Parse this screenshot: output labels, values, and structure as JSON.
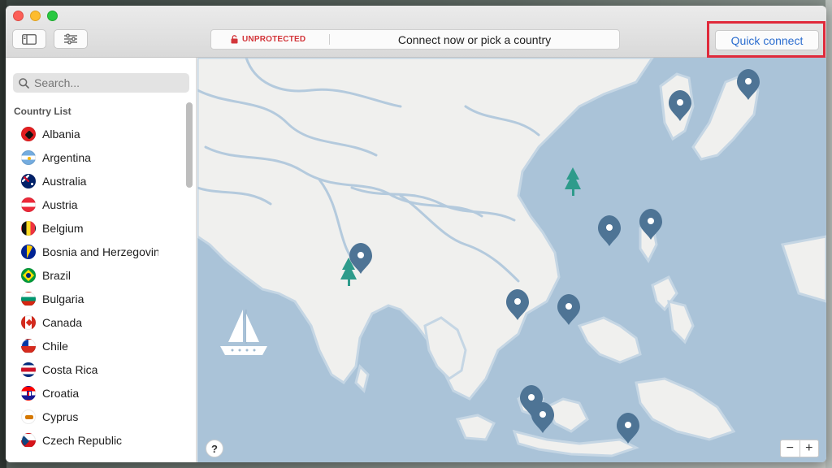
{
  "toolbar": {
    "sidebar_toggle_icon": "sidebar-icon",
    "filter_icon": "sliders-icon"
  },
  "status": {
    "badge": "UNPROTECTED",
    "message": "Connect now or pick a country"
  },
  "quick_connect": {
    "label": "Quick connect"
  },
  "sidebar": {
    "search_placeholder": "Search...",
    "section_label": "Country List",
    "countries": [
      {
        "name": "Albania"
      },
      {
        "name": "Argentina"
      },
      {
        "name": "Australia"
      },
      {
        "name": "Austria"
      },
      {
        "name": "Belgium"
      },
      {
        "name": "Bosnia and Herzegovina"
      },
      {
        "name": "Brazil"
      },
      {
        "name": "Bulgaria"
      },
      {
        "name": "Canada"
      },
      {
        "name": "Chile"
      },
      {
        "name": "Costa Rica"
      },
      {
        "name": "Croatia"
      },
      {
        "name": "Cyprus"
      },
      {
        "name": "Czech Republic"
      }
    ]
  },
  "map": {
    "help_label": "?",
    "zoom_out": "−",
    "zoom_in": "+"
  },
  "colors": {
    "water": "#aac3d8",
    "land": "#f0f0ee",
    "pin": "#4e7495",
    "accent": "#2b6dcf",
    "danger": "#d3353a",
    "highlight": "#e02a3b"
  }
}
